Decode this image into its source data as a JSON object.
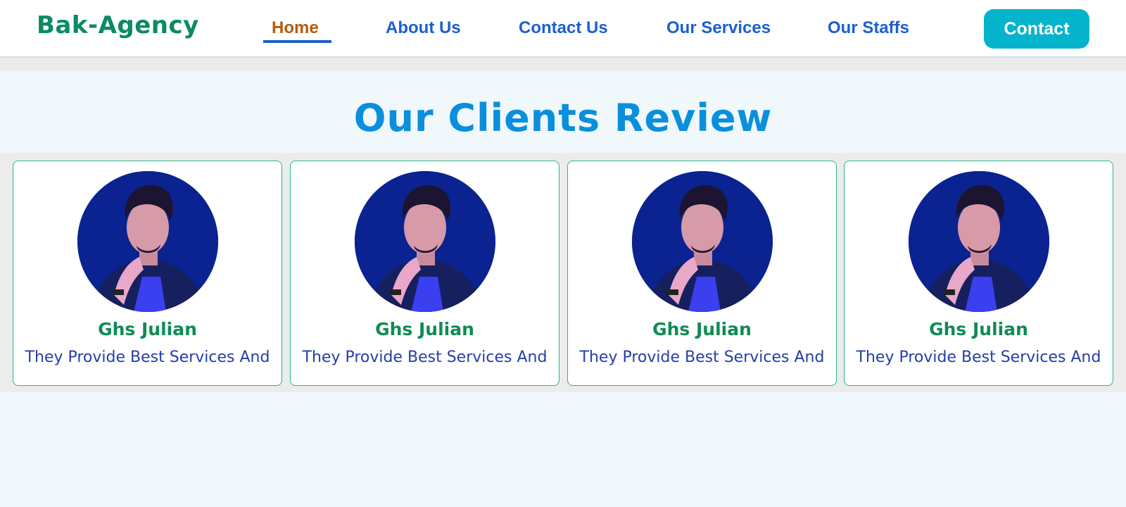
{
  "header": {
    "logo": "Bak-Agency",
    "nav": [
      {
        "label": "Home",
        "active": true
      },
      {
        "label": "About Us",
        "active": false
      },
      {
        "label": "Contact Us",
        "active": false
      },
      {
        "label": "Our Services",
        "active": false
      },
      {
        "label": "Our Staffs",
        "active": false
      }
    ],
    "contact_button": "Contact"
  },
  "reviews": {
    "title": "Our Clients Review",
    "cards": [
      {
        "name": "Ghs Julian",
        "text": "They Provide Best Services And"
      },
      {
        "name": "Ghs Julian",
        "text": "They Provide Best Services And"
      },
      {
        "name": "Ghs Julian",
        "text": "They Provide Best Services And"
      },
      {
        "name": "Ghs Julian",
        "text": "They Provide Best Services And"
      }
    ]
  },
  "colors": {
    "brand_green": "#0b8a64",
    "nav_blue": "#1a5fd1",
    "nav_active": "#b35c0c",
    "cta_cyan": "#04b3cc",
    "title_blue": "#0a8fdc"
  }
}
